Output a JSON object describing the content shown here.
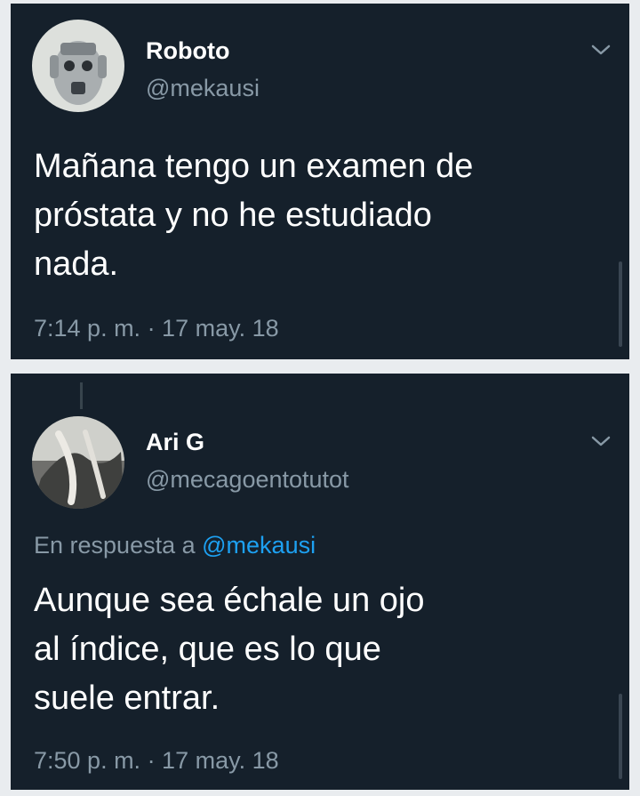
{
  "tweets": [
    {
      "name": "Roboto",
      "handle": "@mekausi",
      "text": "Mañana tengo un examen de\npróstata y no he estudiado\nnada.",
      "timestamp": "7:14 p. m. · 17 may. 18",
      "menu_icon": "chevron-down-icon"
    },
    {
      "name": "Ari G",
      "handle": "@mecagoentotutot",
      "reply_prefix": "En respuesta a",
      "reply_mention": "@mekausi",
      "text": "Aunque sea échale un ojo\nal índice, que es lo que\nsuele entrar.",
      "timestamp": "7:50 p. m. · 17 may. 18",
      "menu_icon": "chevron-down-icon"
    }
  ],
  "colors": {
    "background": "#15202b",
    "text": "#ffffff",
    "secondary_text": "#8899a6",
    "link": "#1da1f2",
    "page_gap": "#e9ecef"
  }
}
